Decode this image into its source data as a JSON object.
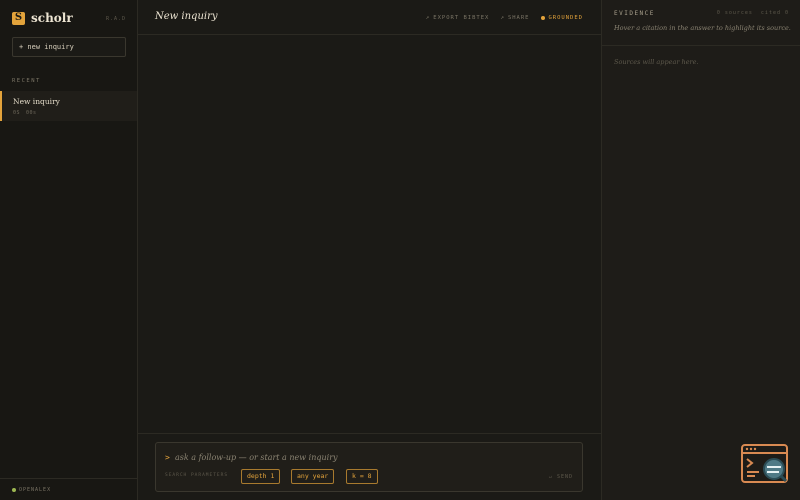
{
  "app": {
    "logo_glyph": "S",
    "name": "scholr",
    "version": "R.A.D"
  },
  "sidebar": {
    "new_button": "+ new inquiry",
    "recent_label": "RECENT",
    "recent": [
      {
        "title": "New inquiry",
        "meta_a": "0S",
        "meta_b": "00s"
      }
    ],
    "footer_source": "OPENALEX"
  },
  "header": {
    "title": "New inquiry",
    "actions": {
      "export": "EXPORT BIBTEX",
      "share": "SHARE",
      "grounded": "GROUNDED"
    }
  },
  "composer": {
    "caret": ">",
    "placeholder": "ask a follow-up — or start a new inquiry",
    "params_label": "SEARCH PARAMETERS",
    "chips": {
      "depth": "depth 1",
      "year": "any year",
      "k": "k = 8"
    },
    "send": "↵ SEND"
  },
  "evidence": {
    "title": "EVIDENCE",
    "sources_count": "0 sources",
    "cited_count": "cited 0",
    "hint": "Hover a citation in the answer to highlight its source.",
    "empty": "Sources will appear here."
  },
  "colors": {
    "accent": "#e3a33b",
    "background": "#1b1a16",
    "source_status": "#9cb651"
  },
  "icons": {
    "export": "export-arrow-icon",
    "share": "share-arrow-icon",
    "grounded": "status-dot-icon",
    "console": "terminal-magnifier-icon"
  }
}
